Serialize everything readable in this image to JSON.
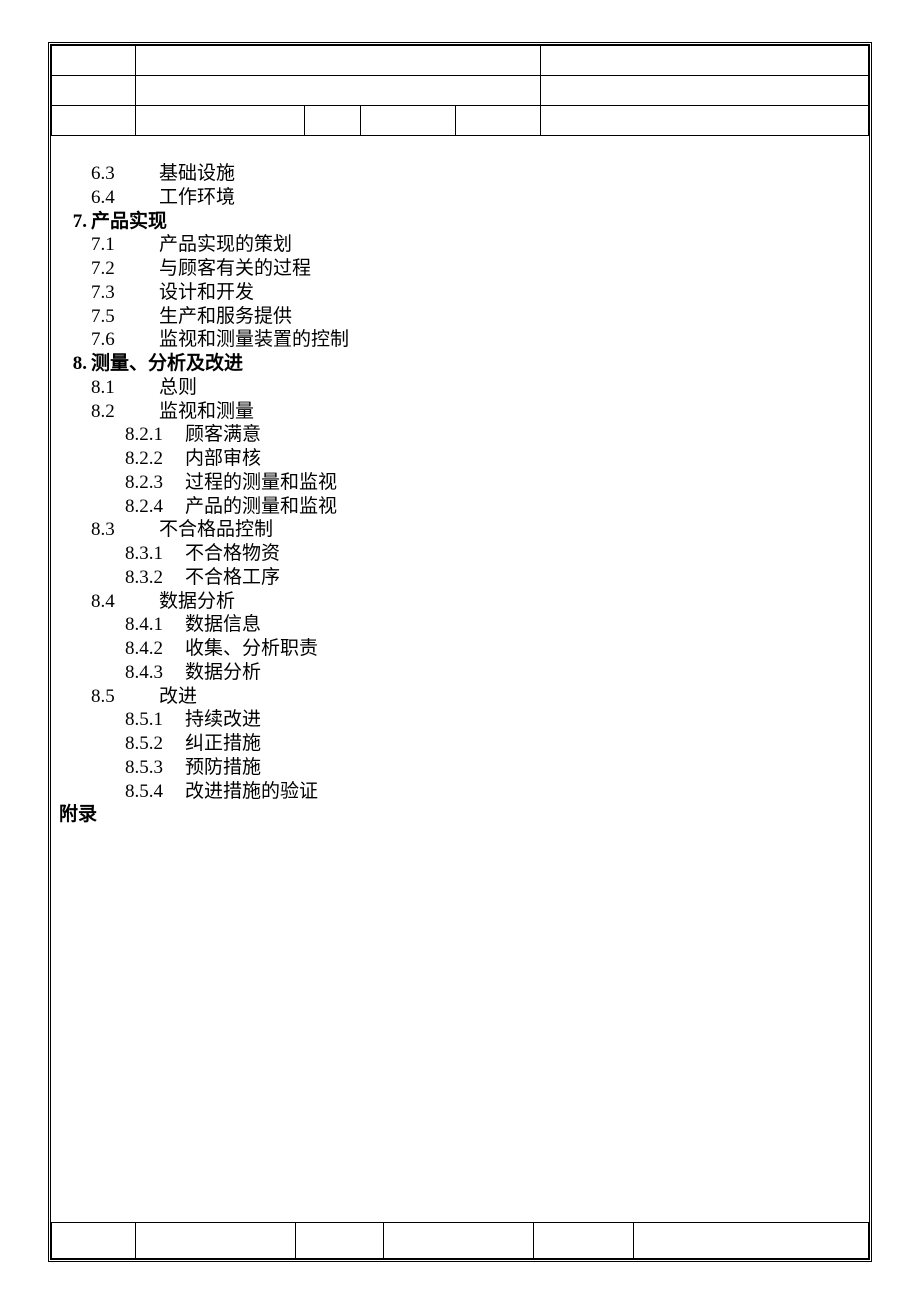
{
  "toc": {
    "pre_items": [
      {
        "num": "6.3",
        "title": "基础设施"
      },
      {
        "num": "6.4",
        "title": "工作环境"
      }
    ],
    "sections": [
      {
        "num": "7.",
        "title": "产品实现",
        "subs": [
          {
            "num": "7.1",
            "title": "产品实现的策划",
            "subs": []
          },
          {
            "num": "7.2",
            "title": "与顾客有关的过程",
            "subs": []
          },
          {
            "num": "7.3",
            "title": "设计和开发",
            "subs": []
          },
          {
            "num": "7.5",
            "title": "生产和服务提供",
            "subs": []
          },
          {
            "num": "7.6",
            "title": "监视和测量装置的控制",
            "subs": []
          }
        ]
      },
      {
        "num": "8.",
        "title": "测量、分析及改进",
        "subs": [
          {
            "num": "8.1",
            "title": "总则",
            "subs": []
          },
          {
            "num": "8.2",
            "title": "监视和测量",
            "subs": [
              {
                "num": "8.2.1",
                "title": "顾客满意"
              },
              {
                "num": "8.2.2",
                "title": "内部审核"
              },
              {
                "num": "8.2.3",
                "title": "过程的测量和监视"
              },
              {
                "num": "8.2.4",
                "title": "产品的测量和监视"
              }
            ]
          },
          {
            "num": "8.3",
            "title": "不合格品控制",
            "subs": [
              {
                "num": "8.3.1",
                "title": "不合格物资"
              },
              {
                "num": "8.3.2",
                "title": "不合格工序"
              }
            ]
          },
          {
            "num": "8.4",
            "title": "数据分析",
            "subs": [
              {
                "num": "8.4.1",
                "title": "数据信息"
              },
              {
                "num": "8.4.2",
                "title": "收集、分析职责"
              },
              {
                "num": "8.4.3",
                "title": "数据分析"
              }
            ]
          },
          {
            "num": "8.5",
            "title": "改进",
            "subs": [
              {
                "num": "8.5.1",
                "title": "持续改进"
              },
              {
                "num": "8.5.2",
                "title": "纠正措施"
              },
              {
                "num": "8.5.3",
                "title": "预防措施"
              },
              {
                "num": "8.5.4",
                "title": "改进措施的验证"
              }
            ]
          }
        ]
      }
    ],
    "appendix": "附录"
  }
}
